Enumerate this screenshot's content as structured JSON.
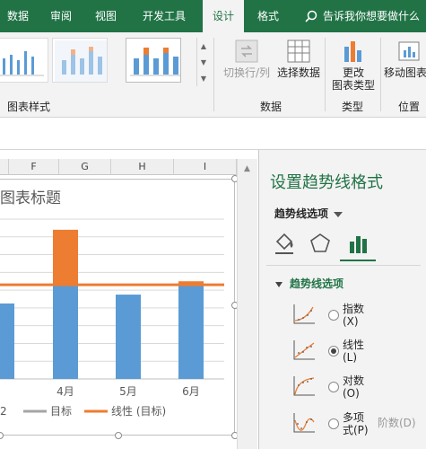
{
  "ribbon": {
    "tabs": [
      {
        "label": "数据",
        "active": false
      },
      {
        "label": "审阅",
        "active": false
      },
      {
        "label": "视图",
        "active": false
      },
      {
        "label": "开发工具",
        "active": false
      },
      {
        "label": "设计",
        "active": true
      },
      {
        "label": "格式",
        "active": false
      }
    ],
    "tell_me": "告诉我你想要做什么",
    "groups": {
      "chart_styles": "图表样式",
      "data": "数据",
      "type": "类型",
      "location": "位置"
    },
    "buttons": {
      "switch_row_col": "切换行/列",
      "select_data": "选择数据",
      "change_type_line1": "更改",
      "change_type_line2": "图表类型",
      "move_chart": "移动图表"
    }
  },
  "sheet": {
    "columns": [
      "F",
      "G",
      "H",
      "I"
    ]
  },
  "chart": {
    "title": "图表标题",
    "legend": [
      {
        "label": "2",
        "color": "#a5a5a5"
      },
      {
        "label": "目标",
        "color": "#a5a5a5"
      },
      {
        "label": "线性 (目标)",
        "color": "#ed7d31"
      }
    ]
  },
  "chart_data": {
    "type": "bar",
    "title": "图表标题",
    "categories": [
      "",
      "4月",
      "5月",
      "6月"
    ],
    "series": [
      {
        "name": "",
        "values": [
          8.5,
          10.5,
          9.5,
          10.5
        ],
        "color": "#5b9bd5"
      },
      {
        "name": "",
        "values": [
          0,
          6.3,
          0,
          0.5
        ],
        "color": "#ed7d31"
      }
    ],
    "trendline": {
      "name": "线性 (目标)",
      "value": 10.6,
      "color": "#ed7d31"
    },
    "ylim": [
      0,
      18
    ],
    "grid": true
  },
  "pane": {
    "title": "设置趋势线格式",
    "options_dropdown": "趋势线选项",
    "section": "趋势线选项",
    "trend_types": [
      {
        "label_line1": "指数",
        "label_line2": "(X)",
        "checked": false
      },
      {
        "label_line1": "线性",
        "label_line2": "(L)",
        "checked": true
      },
      {
        "label_line1": "对数",
        "label_line2": "(O)",
        "checked": false
      },
      {
        "label_line1": "多项",
        "label_line2": "式(P)",
        "checked": false
      }
    ],
    "order_label": "阶数(D)",
    "accent": "#217346"
  }
}
